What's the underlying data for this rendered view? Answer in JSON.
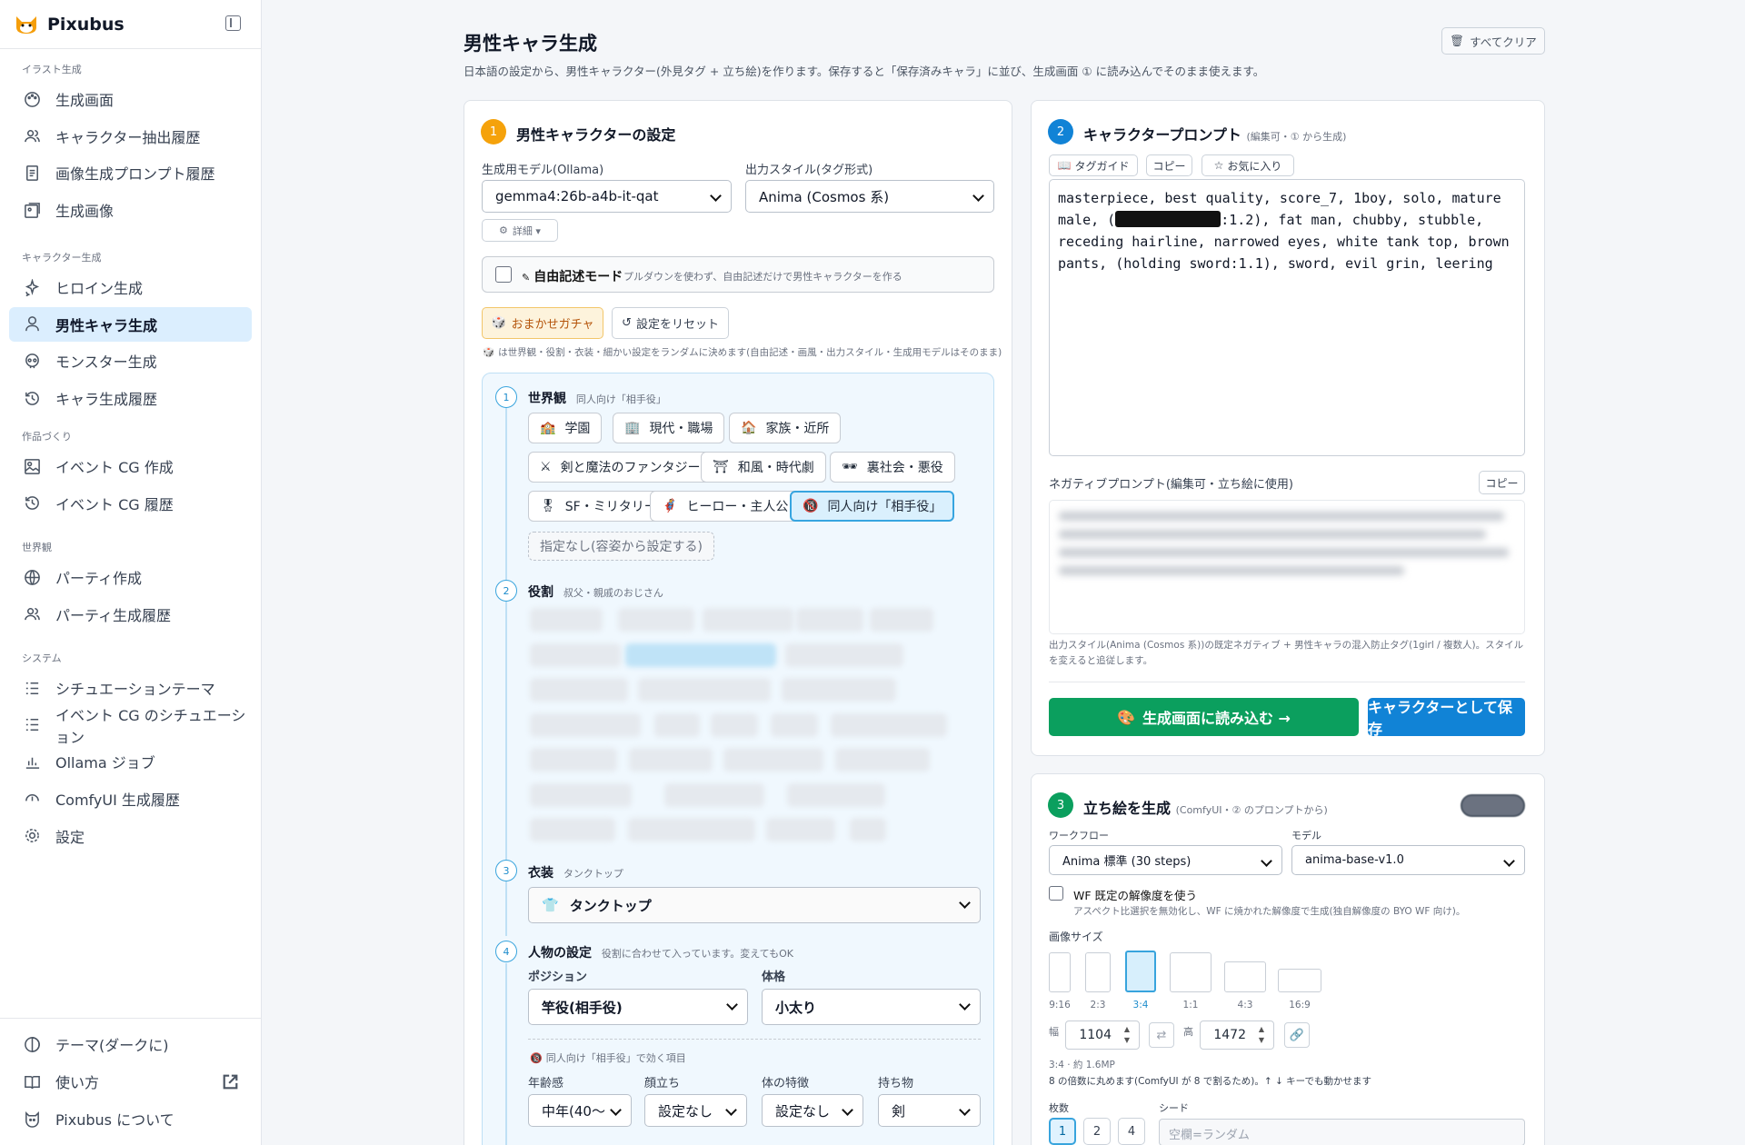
{
  "app": {
    "name": "Pixubus"
  },
  "sidebar": {
    "sections": [
      {
        "title": "イラスト生成",
        "items": [
          {
            "label": "生成画面",
            "icon": "palette-icon"
          },
          {
            "label": "キャラクター抽出履歴",
            "icon": "users-icon"
          },
          {
            "label": "画像生成プロンプト履歴",
            "icon": "doc-list-icon"
          },
          {
            "label": "生成画像",
            "icon": "images-icon"
          }
        ]
      },
      {
        "title": "キャラクター生成",
        "items": [
          {
            "label": "ヒロイン生成",
            "icon": "sparkles-icon"
          },
          {
            "label": "男性キャラ生成",
            "icon": "user-icon",
            "active": true
          },
          {
            "label": "モンスター生成",
            "icon": "skull-icon"
          },
          {
            "label": "キャラ生成履歴",
            "icon": "history-icon"
          }
        ]
      },
      {
        "title": "作品づくり",
        "items": [
          {
            "label": "イベント CG 作成",
            "icon": "image-icon"
          },
          {
            "label": "イベント CG 履歴",
            "icon": "history-icon"
          }
        ]
      },
      {
        "title": "世界観",
        "items": [
          {
            "label": "パーティ作成",
            "icon": "globe-icon"
          },
          {
            "label": "パーティ生成履歴",
            "icon": "users-icon"
          }
        ]
      },
      {
        "title": "システム",
        "items": [
          {
            "label": "シチュエーションテーマ",
            "icon": "list-icon"
          },
          {
            "label": "イベント CG のシチュエーション",
            "icon": "list-icon"
          },
          {
            "label": "Ollama ジョブ",
            "icon": "bar-chart-icon"
          },
          {
            "label": "ComfyUI 生成履歴",
            "icon": "history-arc-icon"
          },
          {
            "label": "設定",
            "icon": "gear-icon"
          }
        ]
      }
    ],
    "footer": [
      {
        "label": "テーマ(ダークに)",
        "icon": "theme-icon"
      },
      {
        "label": "使い方",
        "icon": "book-icon",
        "external": true
      },
      {
        "label": "Pixubus について",
        "icon": "info-cat-icon"
      }
    ]
  },
  "header": {
    "title": "男性キャラ生成",
    "subtitle": "日本語の設定から、男性キャラクター(外見タグ + 立ち絵)を作ります。保存すると「保存済みキャラ」に並び、生成画面 ① に読み込んでそのまま使えます。",
    "clear_all": "すべてクリア"
  },
  "settings": {
    "step": "1",
    "title": "男性キャラクターの設定",
    "model_label": "生成用モデル(Ollama)",
    "model_value": "gemma4:26b-a4b-it-qat",
    "style_label": "出力スタイル(タグ形式)",
    "style_value": "Anima (Cosmos 系)",
    "detail": "詳細 ▾",
    "freeform_label": "自由記述モード",
    "freeform_hint": "プルダウンを使わず、自由記述だけで男性キャラクターを作る",
    "gacha": "おまかせガチャ",
    "reset": "設定をリセット",
    "gacha_hint": "は世界観・役割・衣装・細かい設定をランダムに決めます(自由記述・画風・出力スタイル・生成用モデルはそのまま)",
    "world": {
      "num": "1",
      "title": "世界観",
      "current": "同人向け「相手役」",
      "chips": [
        {
          "emoji": "🏫",
          "label": "学園"
        },
        {
          "emoji": "🏢",
          "label": "現代・職場"
        },
        {
          "emoji": "🏠",
          "label": "家族・近所"
        },
        {
          "emoji": "⚔",
          "label": "剣と魔法のファンタジー"
        },
        {
          "emoji": "⛩",
          "label": "和風・時代劇"
        },
        {
          "emoji": "🕶",
          "label": "裏社会・悪役"
        },
        {
          "emoji": "🎖",
          "label": "SF・ミリタリー"
        },
        {
          "emoji": "🦸",
          "label": "ヒーロー・主人公"
        },
        {
          "emoji": "🔞",
          "label": "同人向け「相手役」",
          "selected": true
        }
      ],
      "none_label": "指定なし(容姿から設定する)"
    },
    "role": {
      "num": "2",
      "title": "役割",
      "current": "叔父・親戚のおじさん"
    },
    "outfit": {
      "num": "3",
      "title": "衣装",
      "current": "タンクトップ",
      "value": "タンクトップ"
    },
    "person": {
      "num": "4",
      "title": "人物の設定",
      "hint": "役割に合わせて入っています。変えてもOK",
      "position_label": "ポジション",
      "position_value": "竿役(相手役)",
      "body_label": "体格",
      "body_value": "小太り",
      "note": "同人向け「相手役」で効く項目",
      "age_label": "年齢感",
      "age_value": "中年(40〜",
      "face_label": "顔立ち",
      "face_value": "設定なし",
      "feature_label": "体の特徴",
      "feature_value": "設定なし",
      "item_label": "持ち物",
      "item_value": "剣"
    }
  },
  "prompt": {
    "step": "2",
    "title": "キャラクタープロンプト",
    "title_note": "(編集可・① から生成)",
    "tag_guide": "タグガイド",
    "copy": "コピー",
    "favorite": "お気に入り",
    "text_before": "masterpiece, best quality, score_7, 1boy, solo, mature male, (",
    "text_after": ":1.2), fat man, chubby, stubble, receding hairline, narrowed eyes, white tank top, brown pants, (holding sword:1.1), sword, evil grin, leering",
    "neg_label": "ネガティブプロンプト(編集可・立ち絵に使用)",
    "neg_copy": "コピー",
    "neg_hint": "出力スタイル(Anima (Cosmos 系))の既定ネガティブ + 男性キャラの混入防止タグ(1girl / 複数人)。スタイルを変えると追従します。",
    "load_btn": "生成画面に読み込む →",
    "save_btn": "キャラクターとして保存",
    "accent_green": "#0b9f5e",
    "accent_blue": "#1183d6"
  },
  "portrait": {
    "step": "3",
    "title": "立ち絵を生成",
    "title_note": "(ComfyUI・② のプロンプトから)",
    "workflow_label": "ワークフロー",
    "workflow_value": "Anima 標準 (30 steps)",
    "model_label": "モデル",
    "model_value": "anima-base-v1.0",
    "wf_res_label": "WF 既定の解像度を使う",
    "wf_res_hint": "アスペクト比選択を無効化し、WF に焼かれた解像度で生成(独自解像度の BYO WF 向け)。",
    "size_label": "画像サイズ",
    "ratios": [
      "9:16",
      "2:3",
      "3:4",
      "1:1",
      "4:3",
      "16:9"
    ],
    "selected_ratio": "3:4",
    "width_label": "幅",
    "width": "1104",
    "height_label": "高",
    "height": "1472",
    "size_info": "3:4 · 約 1.6MP",
    "size_hint": "8 の倍数に丸めます(ComfyUI が 8 で割るため)。↑ ↓ キーでも動かせます",
    "count_label": "枚数",
    "counts": [
      "1",
      "2",
      "4"
    ],
    "seed_label": "シード",
    "seed_placeholder": "空欄=ランダム"
  }
}
